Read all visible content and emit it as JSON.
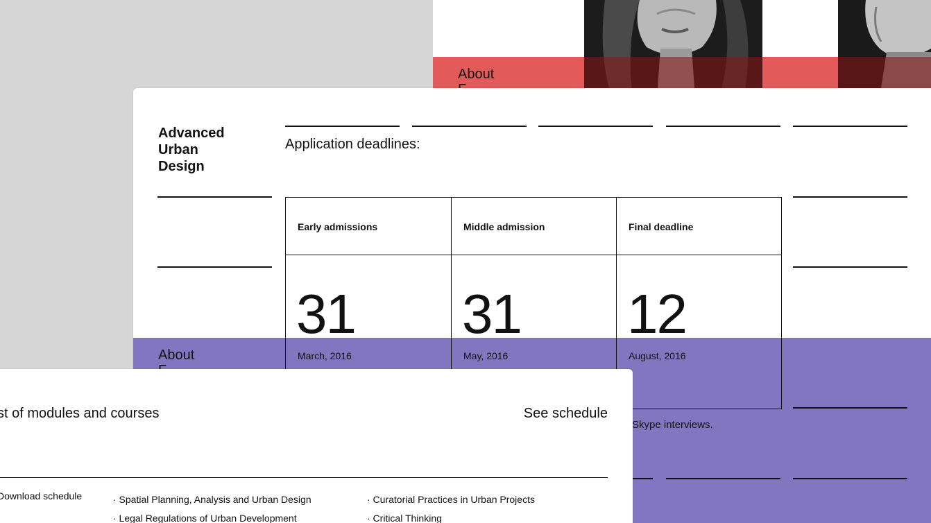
{
  "back_card": {
    "about": "About\nF",
    "band_color": "#e35a5a"
  },
  "middle_card": {
    "title": "Advanced\nUrban\nDesign",
    "deadlines_heading": "Application deadlines:",
    "about": "About\nF",
    "note": "Skype interviews.",
    "band_color": "#8176bf",
    "deadlines": [
      {
        "label": "Early admissions",
        "day": "31",
        "month": "March, 2016"
      },
      {
        "label": "Middle admission",
        "day": "31",
        "month": "May, 2016"
      },
      {
        "label": "Final deadline",
        "day": "12",
        "month": "August, 2016"
      }
    ]
  },
  "front_card": {
    "list_title": "st of modules and courses",
    "see_schedule": "See schedule",
    "download": "Download schedule",
    "modules_col1": [
      "· Spatial Planning, Analysis and Urban Design",
      "· Legal Regulations of Urban Development"
    ],
    "modules_col2": [
      "· Curatorial Practices in Urban Projects",
      "· Critical Thinking"
    ]
  }
}
